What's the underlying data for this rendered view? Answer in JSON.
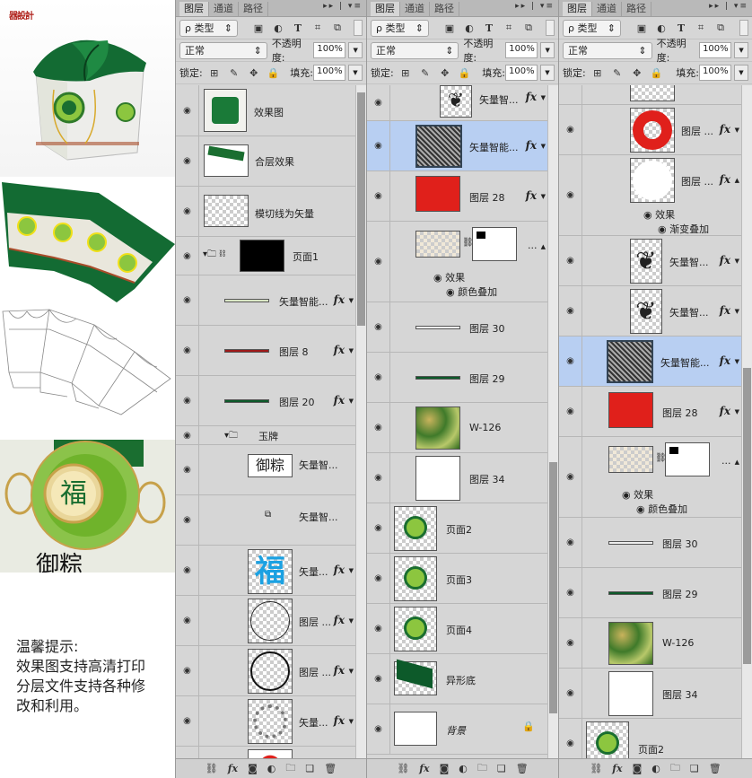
{
  "left": {
    "logo": "器設計",
    "note": {
      "title": "温馨提示:",
      "lines": [
        "效果图支持高清打印",
        "分层文件支持各种修",
        "改和利用。"
      ]
    }
  },
  "panel_common": {
    "tabs": [
      "图层",
      "通道",
      "路径"
    ],
    "tab_menu": "▸▸ | ▾≡",
    "filter_label": "ρ 类型",
    "filter_icons": [
      "image-icon",
      "adjustment-icon",
      "text-icon",
      "shape-icon",
      "smart-object-icon"
    ],
    "blend_mode": "正常",
    "opacity_label": "不透明度:",
    "opacity_value": "100%",
    "lock_label": "锁定:",
    "fill_label": "填充:",
    "fill_value": "100%",
    "bottom_icons": [
      "link-icon",
      "fx-icon",
      "mask-icon",
      "adjustment-layer-icon",
      "group-icon",
      "new-layer-icon",
      "trash-icon"
    ]
  },
  "panel1": {
    "layers": [
      {
        "name": "效果图"
      },
      {
        "name": "合层效果"
      },
      {
        "name": "模切线为矢量"
      },
      {
        "name": "页面1"
      },
      {
        "name": "矢量智能...",
        "fx": "fx"
      },
      {
        "name": "图层 8",
        "fx": "fx"
      },
      {
        "name": "图层 20",
        "fx": "fx"
      },
      {
        "name": "玉牌"
      },
      {
        "name": "矢量智..."
      },
      {
        "name": "矢量智..."
      },
      {
        "name": "矢量...",
        "fx": "fx"
      },
      {
        "name": "图层 ...",
        "fx": "fx"
      },
      {
        "name": "图层 ...",
        "fx": "fx"
      },
      {
        "name": "矢量...",
        "fx": "fx"
      }
    ]
  },
  "panel2": {
    "layers": [
      {
        "name": "矢量智...",
        "fx": "fx"
      },
      {
        "name": "矢量智能...",
        "fx": "fx"
      },
      {
        "name": "图层 28",
        "fx": "fx"
      },
      {
        "name": "...",
        "effects": "效果",
        "effect1": "颜色叠加"
      },
      {
        "name": "图层 30"
      },
      {
        "name": "图层 29"
      },
      {
        "name": "W-126"
      },
      {
        "name": "图层 34"
      },
      {
        "name": "页面2"
      },
      {
        "name": "页面3"
      },
      {
        "name": "页面4"
      },
      {
        "name": "异形底"
      },
      {
        "name": "背景"
      }
    ]
  },
  "panel3": {
    "layers": [
      {
        "name": "图层 ...",
        "fx": "fx"
      },
      {
        "name": "图层 ...",
        "fx": "fx",
        "effects": "效果",
        "effect1": "渐变叠加"
      },
      {
        "name": "矢量智...",
        "fx": "fx"
      },
      {
        "name": "矢量智...",
        "fx": "fx"
      },
      {
        "name": "矢量智能...",
        "fx": "fx"
      },
      {
        "name": "图层 28",
        "fx": "fx"
      },
      {
        "name": "...",
        "effects": "效果",
        "effect1": "颜色叠加"
      },
      {
        "name": "图层 30"
      },
      {
        "name": "图层 29"
      },
      {
        "name": "W-126"
      },
      {
        "name": "图层 34"
      },
      {
        "name": "页面2"
      }
    ]
  },
  "colors": {
    "selected_layer": "#b8cff2",
    "red": "#e0201b",
    "green": "#0d5a2a",
    "dark_red": "#9e1a1a",
    "cyan": "#1ba1e2"
  }
}
